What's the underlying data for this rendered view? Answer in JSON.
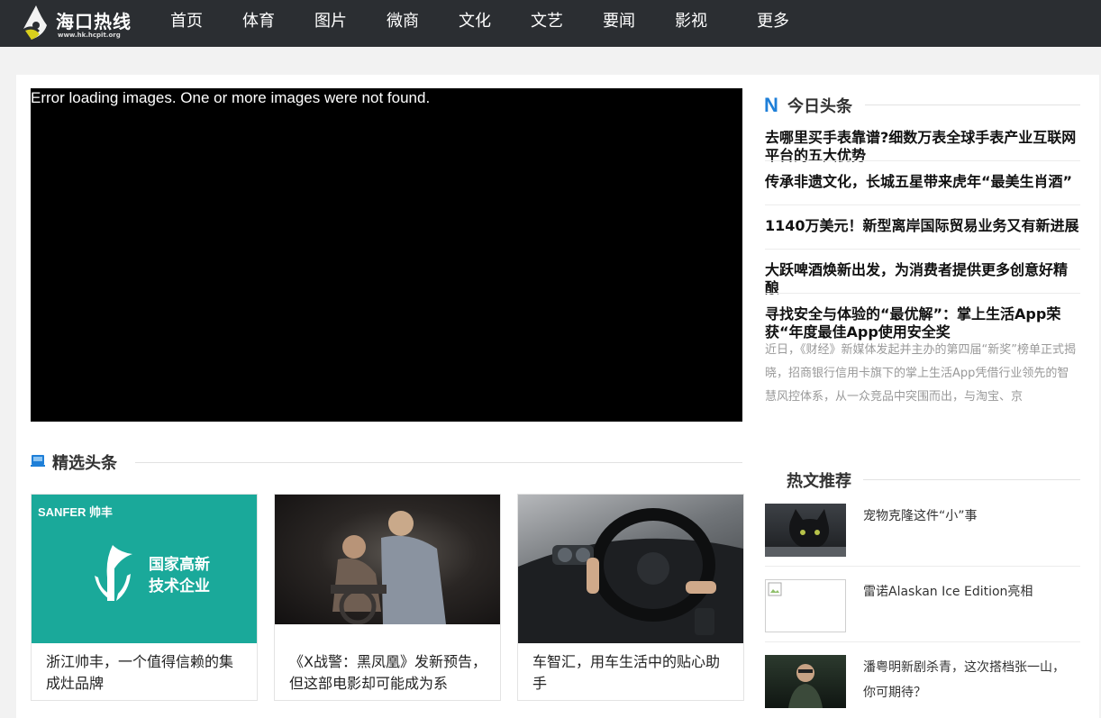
{
  "site": {
    "logo_name": "海口热线",
    "logo_url": "www.hk.hcpit.org"
  },
  "nav": [
    "首页",
    "体育",
    "图片",
    "微商",
    "文化",
    "文艺",
    "要闻",
    "影视",
    "更多"
  ],
  "slider": {
    "error_text": "Error loading images. One or more images were not found."
  },
  "today": {
    "icon_letter": "N",
    "title": "今日头条",
    "headlines": [
      "去哪里买手表靠谱?细数万表全球手表产业互联网平台的五大优势",
      "传承非遗文化，长城五星带来虎年“最美生肖酒”",
      "1140万美元！新型离岸国际贸易业务又有新进展",
      "大跃啤酒焕新出发，为消费者提供更多创意好精酿",
      "寻找安全与体验的“最优解”：掌上生活App荣获“年度最佳App使用安全奖"
    ],
    "summary": "近日，《财经》新媒体发起并主办的第四届“新奖”榜单正式揭晓，招商银行信用卡旗下的掌上生活App凭借行业领先的智慧风控体系，从一众竞品中突围而出，与淘宝、京"
  },
  "featured": {
    "title": "精选头条",
    "cards": [
      {
        "caption": "浙江帅丰，一个值得信赖的集成灶品牌",
        "brand": "SANFER 帅丰",
        "badge_line1": "国家高新",
        "badge_line2": "技术企业"
      },
      {
        "caption": "《X战警：黑凤凰》发新预告，但这部电影却可能成为系"
      },
      {
        "caption": "车智汇，用车生活中的贴心助手"
      }
    ]
  },
  "hot": {
    "title": "热文推荐",
    "items": [
      "宠物克隆这件“小”事",
      "雷诺Alaskan Ice Edition亮相",
      "潘粤明新剧杀青，这次搭档张一山，你可期待？"
    ]
  },
  "colors": {
    "topbar": "#2b2e32",
    "accent": "#1e7fd8",
    "teal": "#1aa99a"
  }
}
